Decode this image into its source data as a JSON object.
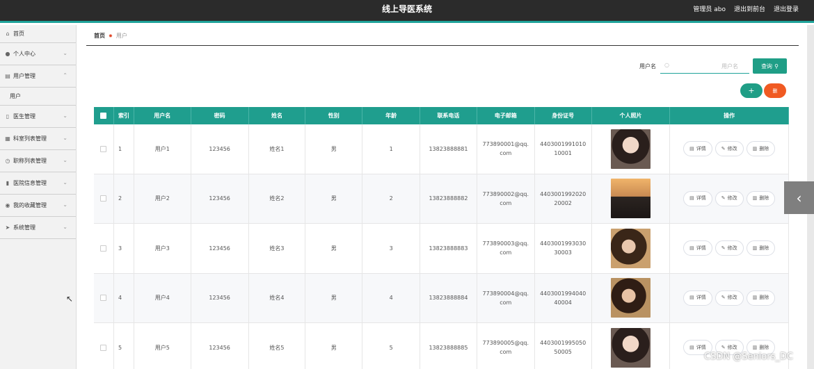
{
  "header": {
    "title": "线上导医系统",
    "admin_label": "管理员 abo",
    "back_label": "退出到前台",
    "logout_label": "退出登录"
  },
  "sidebar": {
    "items": [
      {
        "label": "首页",
        "icon": "home-icon"
      },
      {
        "label": "个人中心",
        "icon": "user-icon"
      },
      {
        "label": "用户管理",
        "icon": "list-icon"
      },
      {
        "label": "医生管理",
        "icon": "doc-icon"
      },
      {
        "label": "科室列表管理",
        "icon": "table-icon"
      },
      {
        "label": "职称列表管理",
        "icon": "clock-icon"
      },
      {
        "label": "医院信息管理",
        "icon": "chart-icon"
      },
      {
        "label": "我的收藏管理",
        "icon": "pin-icon"
      },
      {
        "label": "系统管理",
        "icon": "send-icon"
      }
    ],
    "sub_item": "用户"
  },
  "breadcrumb": {
    "home": "首页",
    "current": "用户"
  },
  "search": {
    "label": "用户名",
    "placeholder": "用户名",
    "button": "查询"
  },
  "actions": {
    "add": "+",
    "delete": "删"
  },
  "table": {
    "headers": [
      "",
      "索引",
      "用户名",
      "密码",
      "姓名",
      "性别",
      "年龄",
      "联系电话",
      "电子邮箱",
      "身份证号",
      "个人照片",
      "操作"
    ],
    "ops": {
      "detail": "详情",
      "edit": "修改",
      "delete": "删除"
    },
    "rows": [
      {
        "idx": "1",
        "user": "用户1",
        "pwd": "123456",
        "name": "姓名1",
        "sex": "男",
        "age": "1",
        "phone": "13823888881",
        "email": "773890001@qq.com",
        "idcard": "440300199101010001"
      },
      {
        "idx": "2",
        "user": "用户2",
        "pwd": "123456",
        "name": "姓名2",
        "sex": "男",
        "age": "2",
        "phone": "13823888882",
        "email": "773890002@qq.com",
        "idcard": "440300199202020002"
      },
      {
        "idx": "3",
        "user": "用户3",
        "pwd": "123456",
        "name": "姓名3",
        "sex": "男",
        "age": "3",
        "phone": "13823888883",
        "email": "773890003@qq.com",
        "idcard": "440300199303030003"
      },
      {
        "idx": "4",
        "user": "用户4",
        "pwd": "123456",
        "name": "姓名4",
        "sex": "男",
        "age": "4",
        "phone": "13823888884",
        "email": "773890004@qq.com",
        "idcard": "440300199404040004"
      },
      {
        "idx": "5",
        "user": "用户5",
        "pwd": "123456",
        "name": "姓名5",
        "sex": "男",
        "age": "5",
        "phone": "13823888885",
        "email": "773890005@qq.com",
        "idcard": "440300199505050005"
      }
    ]
  },
  "watermark": "CSDN @Seniors_DC"
}
